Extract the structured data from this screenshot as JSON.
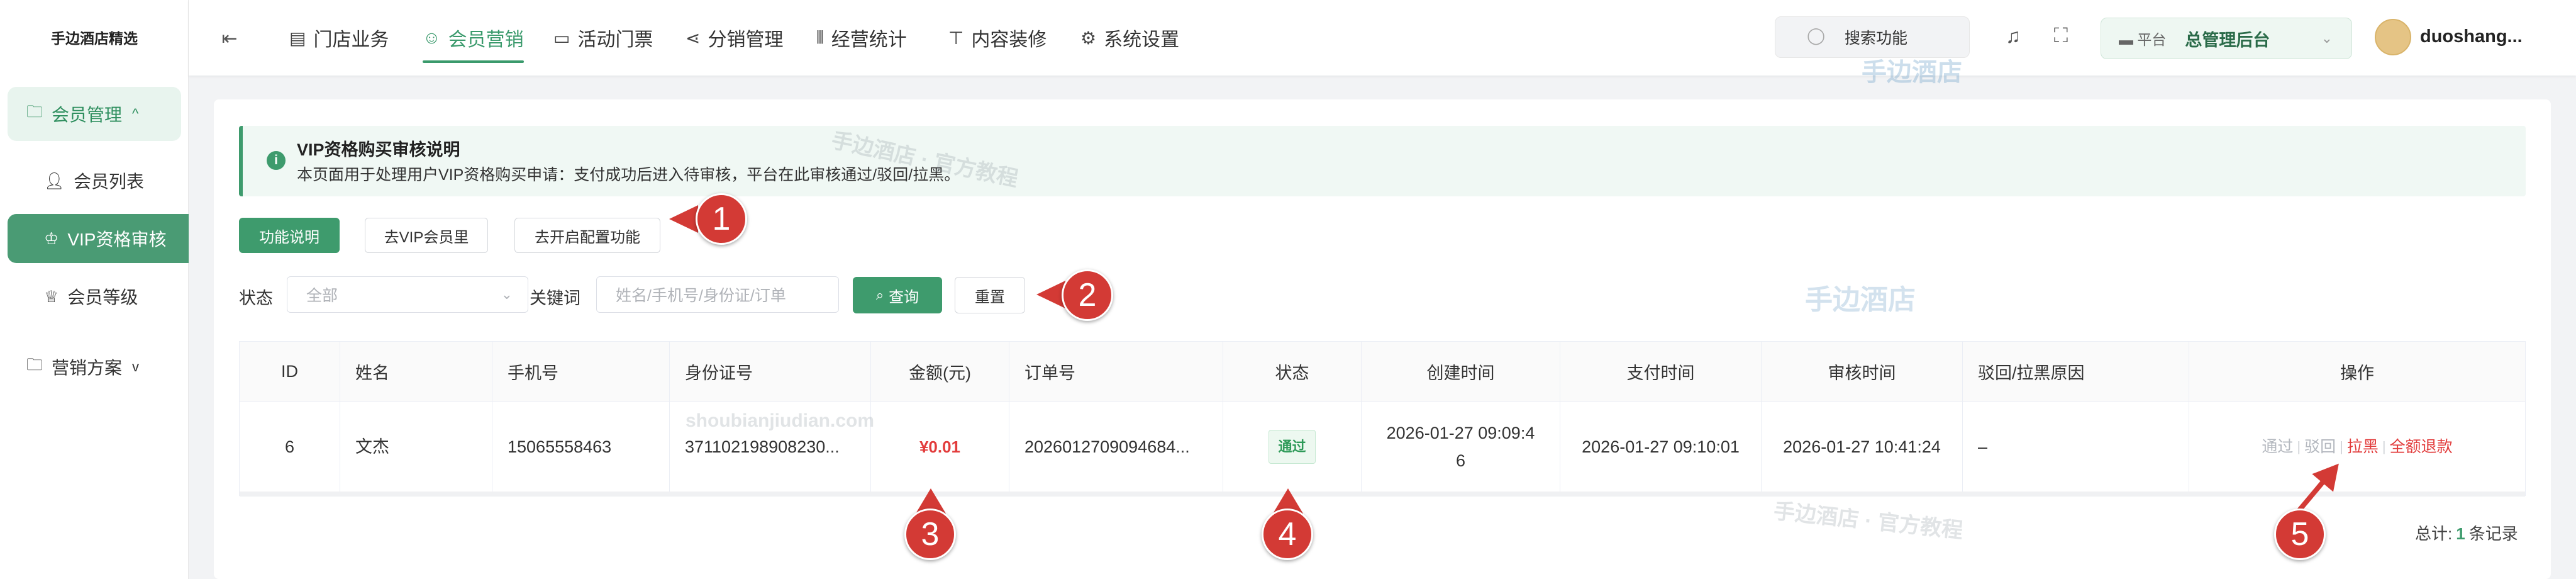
{
  "app": {
    "logo": "手边酒店精选"
  },
  "sidebar": {
    "items": [
      {
        "label": "会员管理",
        "chevron": "^",
        "active": true
      },
      {
        "label": "会员列表"
      },
      {
        "label": "VIP资格审核",
        "active": true
      },
      {
        "label": "会员等级"
      },
      {
        "label": "营销方案",
        "chevron": "v"
      }
    ]
  },
  "header": {
    "nav": [
      {
        "label": "门店业务",
        "icon": "store-icon"
      },
      {
        "label": "会员营销",
        "icon": "member-icon",
        "active": true
      },
      {
        "label": "活动门票",
        "icon": "ticket-icon"
      },
      {
        "label": "分销管理",
        "icon": "share-icon"
      },
      {
        "label": "经营统计",
        "icon": "chart-icon"
      },
      {
        "label": "内容装修",
        "icon": "brush-icon"
      },
      {
        "label": "系统设置",
        "icon": "gear-icon"
      }
    ],
    "search_label": "搜索功能",
    "platform_tag": "平台",
    "platform_value": "总管理后台",
    "username": "duoshang..."
  },
  "notice": {
    "title": "VIP资格购买审核说明",
    "desc": "本页面用于处理用户VIP资格购买申请：支付成功后进入待审核，平台在此审核通过/驳回/拉黑。"
  },
  "actions": {
    "intro": "功能说明",
    "go_vip": "去VIP会员里",
    "go_config": "去开启配置功能"
  },
  "filters": {
    "status_label": "状态",
    "status_placeholder": "全部",
    "keyword_label": "关键词",
    "keyword_placeholder": "姓名/手机号/身份证/订单",
    "query": "查询",
    "reset": "重置"
  },
  "table": {
    "columns": [
      "ID",
      "姓名",
      "手机号",
      "身份证号",
      "金额(元)",
      "订单号",
      "状态",
      "创建时间",
      "支付时间",
      "审核时间",
      "驳回/拉黑原因",
      "操作"
    ],
    "rows": [
      {
        "id": "6",
        "name": "文杰",
        "phone": "15065558463",
        "id_card": "371102198908230...",
        "amount": "¥0.01",
        "order": "2026012709094684...",
        "status": "通过",
        "created_line1": "2026-01-27 09:09:4",
        "created_line2": "6",
        "paid": "2026-01-27 09:10:01",
        "reviewed": "2026-01-27 10:41:24",
        "reason": "–",
        "ops": {
          "approve": "通过",
          "reject": "驳回",
          "block": "拉黑",
          "refund": "全额退款"
        }
      }
    ]
  },
  "pagination": {
    "prefix": "总计:",
    "count": "1",
    "suffix": "条记录"
  },
  "annotations": [
    "1",
    "2",
    "3",
    "4",
    "5"
  ],
  "watermarks": {
    "brand": "手边酒店",
    "tutorial": "手边酒店 · 官方教程",
    "domain": "shoubianjiudian.com"
  },
  "colors": {
    "primary": "#3e9b6d",
    "danger": "#e23b3b",
    "annotation": "#d33a35"
  }
}
